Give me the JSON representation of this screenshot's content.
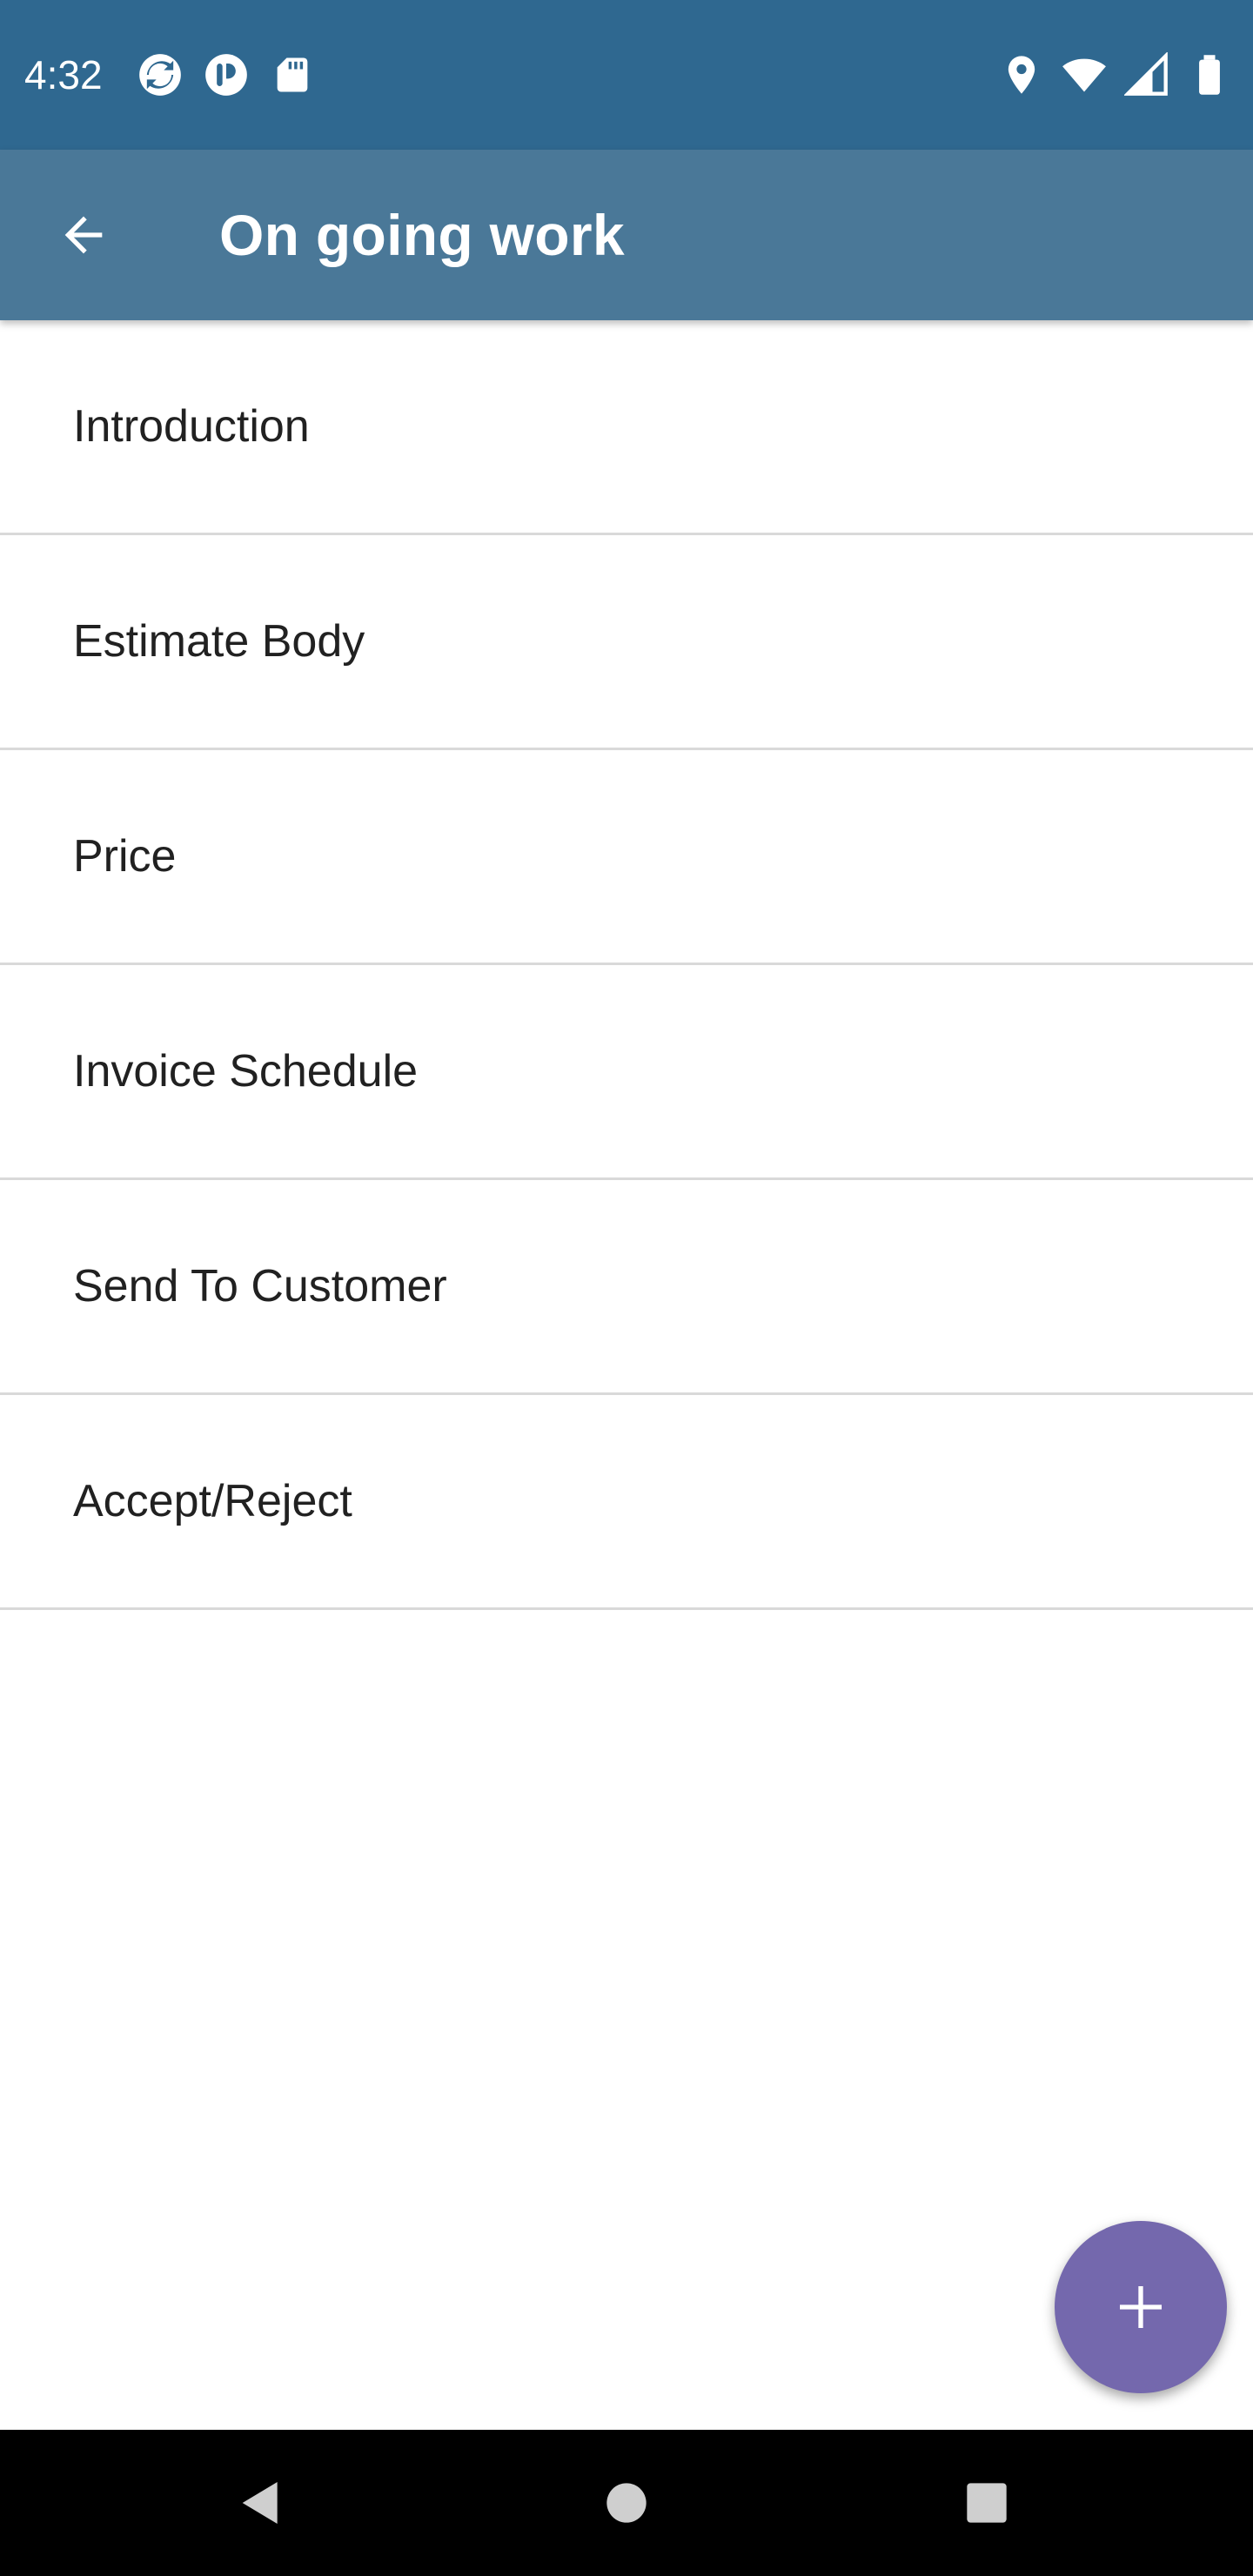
{
  "status_bar": {
    "time": "4:32",
    "left_icons": [
      "sync-icon",
      "app-notification-icon",
      "sd-card-icon"
    ],
    "right_icons": [
      "location-icon",
      "wifi-icon",
      "signal-icon",
      "battery-icon"
    ]
  },
  "app_bar": {
    "back_icon": "arrow-back-icon",
    "title": "On going work",
    "color": "#4a7898"
  },
  "status_bar_color": "#2f6890",
  "sections": [
    {
      "label": "Introduction"
    },
    {
      "label": "Estimate Body"
    },
    {
      "label": "Price"
    },
    {
      "label": "Invoice Schedule"
    },
    {
      "label": "Send To Customer"
    },
    {
      "label": "Accept/Reject"
    }
  ],
  "fab": {
    "icon": "plus-icon",
    "color": "#7468ad"
  },
  "nav_bar": {
    "buttons": [
      "back-triangle-icon",
      "home-circle-icon",
      "recents-square-icon"
    ]
  }
}
